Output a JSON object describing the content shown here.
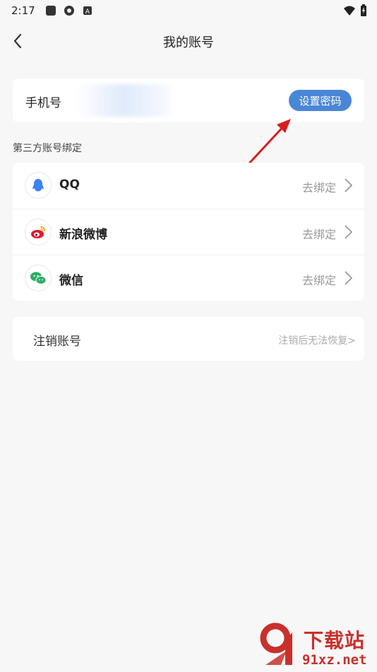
{
  "status_bar": {
    "time": "2:17"
  },
  "header": {
    "title": "我的账号"
  },
  "phone": {
    "label": "手机号",
    "set_password_label": "设置密码"
  },
  "third_party": {
    "section_label": "第三方账号绑定",
    "items": [
      {
        "name": "QQ",
        "action": "去绑定",
        "icon": "qq-icon",
        "color": "#3b82f6"
      },
      {
        "name": "新浪微博",
        "action": "去绑定",
        "icon": "weibo-icon",
        "color": "#e6162d"
      },
      {
        "name": "微信",
        "action": "去绑定",
        "icon": "wechat-icon",
        "color": "#2aae67"
      }
    ]
  },
  "cancel_account": {
    "label": "注销账号",
    "hint": "注销后无法恢复>"
  },
  "watermark": {
    "brand": "下载站",
    "domain": "91xz.net"
  },
  "colors": {
    "accent": "#4a86d8",
    "background": "#f7f7f7"
  }
}
